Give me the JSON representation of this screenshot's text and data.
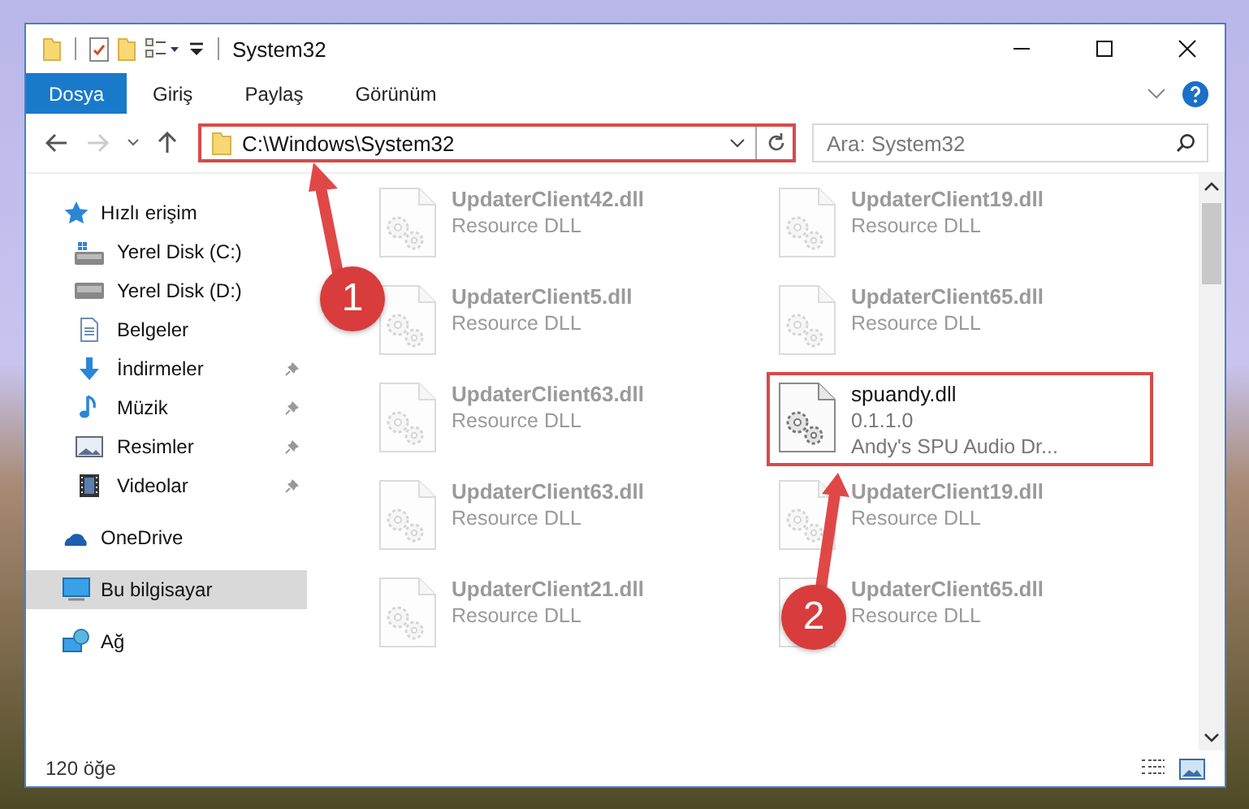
{
  "window": {
    "title": "System32"
  },
  "ribbon_tabs": [
    {
      "label": "Dosya",
      "kind": "file",
      "selected": false
    },
    {
      "label": "Giriş",
      "kind": "tab",
      "selected": false
    },
    {
      "label": "Paylaş",
      "kind": "tab",
      "selected": false
    },
    {
      "label": "Görünüm",
      "kind": "tab",
      "selected": false
    }
  ],
  "address_bar": {
    "path": "C:\\Windows\\System32",
    "highlighted": true
  },
  "search": {
    "placeholder": "Ara: System32"
  },
  "sidebar": {
    "items": [
      {
        "label": "Hızlı erişim",
        "kind": "star",
        "selected": false,
        "children": [
          {
            "label": "Yerel Disk (C:)",
            "kind": "drive-system",
            "pinned": false,
            "selected": false
          },
          {
            "label": "Yerel Disk (D:)",
            "kind": "drive",
            "pinned": false,
            "selected": false
          },
          {
            "label": "Belgeler",
            "kind": "documents",
            "pinned": false,
            "selected": false
          },
          {
            "label": "İndirmeler",
            "kind": "downloads",
            "pinned": true,
            "selected": false
          },
          {
            "label": "Müzik",
            "kind": "music",
            "pinned": true,
            "selected": false
          },
          {
            "label": "Resimler",
            "kind": "pictures",
            "pinned": true,
            "selected": false
          },
          {
            "label": "Videolar",
            "kind": "videos",
            "pinned": true,
            "selected": false
          }
        ]
      },
      {
        "label": "OneDrive",
        "kind": "cloud",
        "selected": false
      },
      {
        "label": "Bu bilgisayar",
        "kind": "computer",
        "selected": true
      },
      {
        "label": "Ağ",
        "kind": "network",
        "selected": false
      }
    ]
  },
  "files": [
    {
      "name": "UpdaterClient42.dll",
      "lines": [
        "Resource DLL"
      ],
      "highlighted": false
    },
    {
      "name": "UpdaterClient19.dll",
      "lines": [
        "Resource DLL"
      ],
      "highlighted": false
    },
    {
      "name": "UpdaterClient5.dll",
      "lines": [
        "Resource DLL"
      ],
      "highlighted": false
    },
    {
      "name": "UpdaterClient65.dll",
      "lines": [
        "Resource DLL"
      ],
      "highlighted": false
    },
    {
      "name": "UpdaterClient63.dll",
      "lines": [
        "Resource DLL"
      ],
      "highlighted": false
    },
    {
      "name": "spuandy.dll",
      "lines": [
        "0.1.1.0",
        "Andy's SPU Audio Dr..."
      ],
      "highlighted": true
    },
    {
      "name": "UpdaterClient63.dll",
      "lines": [
        "Resource DLL"
      ],
      "highlighted": false
    },
    {
      "name": "UpdaterClient19.dll",
      "lines": [
        "Resource DLL"
      ],
      "highlighted": false
    },
    {
      "name": "UpdaterClient21.dll",
      "lines": [
        "Resource DLL"
      ],
      "highlighted": false
    },
    {
      "name": "UpdaterClient65.dll",
      "lines": [
        "Resource DLL"
      ],
      "highlighted": false
    }
  ],
  "status_bar": {
    "item_count": "120 öğe"
  },
  "annotations": [
    {
      "number": "1"
    },
    {
      "number": "2"
    }
  ]
}
